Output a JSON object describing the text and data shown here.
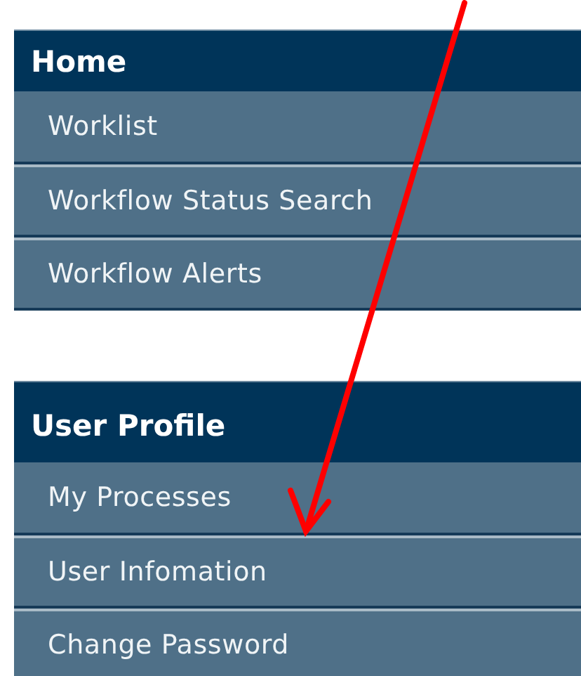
{
  "menus": [
    {
      "title": "Home",
      "items": [
        {
          "label": "Worklist"
        },
        {
          "label": "Workflow Status Search"
        },
        {
          "label": "Workflow Alerts"
        }
      ]
    },
    {
      "title": "User Profile",
      "items": [
        {
          "label": "My Processes"
        },
        {
          "label": "User Infomation"
        },
        {
          "label": "Change Password"
        }
      ]
    }
  ]
}
